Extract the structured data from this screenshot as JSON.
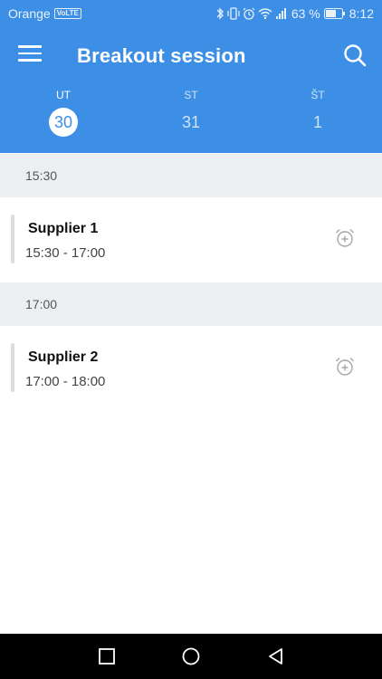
{
  "status_bar": {
    "carrier": "Orange",
    "volte": "VoLTE",
    "battery": "63 %",
    "time": "8:12"
  },
  "app_bar": {
    "title": "Breakout session"
  },
  "days": [
    {
      "name": "UT",
      "number": "30",
      "selected": true
    },
    {
      "name": "ST",
      "number": "31",
      "selected": false
    },
    {
      "name": "ŠT",
      "number": "1",
      "selected": false
    }
  ],
  "sections": [
    {
      "header": "15:30",
      "session": {
        "name": "Supplier 1",
        "time": "15:30 - 17:00"
      }
    },
    {
      "header": "17:00",
      "session": {
        "name": "Supplier 2",
        "time": "17:00 - 18:00"
      }
    }
  ],
  "colors": {
    "primary": "#3d8fe6",
    "section_bg": "#eceef1"
  }
}
